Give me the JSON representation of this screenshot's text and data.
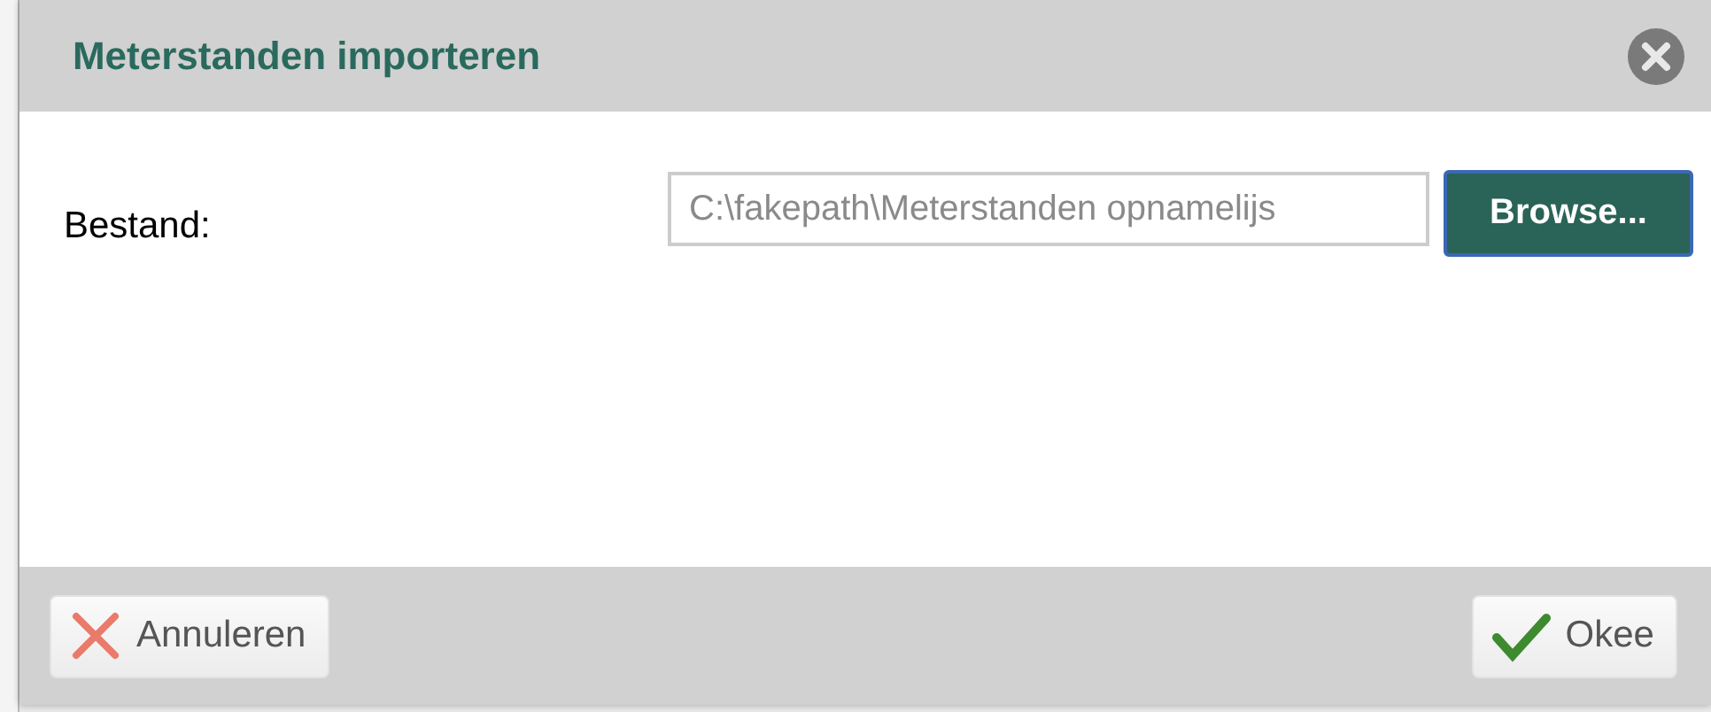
{
  "dialog": {
    "title": "Meterstanden importeren"
  },
  "file_field": {
    "label": "Bestand:",
    "value": "C:\\fakepath\\Meterstanden opnamelijs",
    "button": "Browse..."
  },
  "buttons": [
    {
      "kind": "cancel",
      "label": "Annuleren"
    },
    {
      "kind": "ok",
      "label": "Okee"
    }
  ]
}
